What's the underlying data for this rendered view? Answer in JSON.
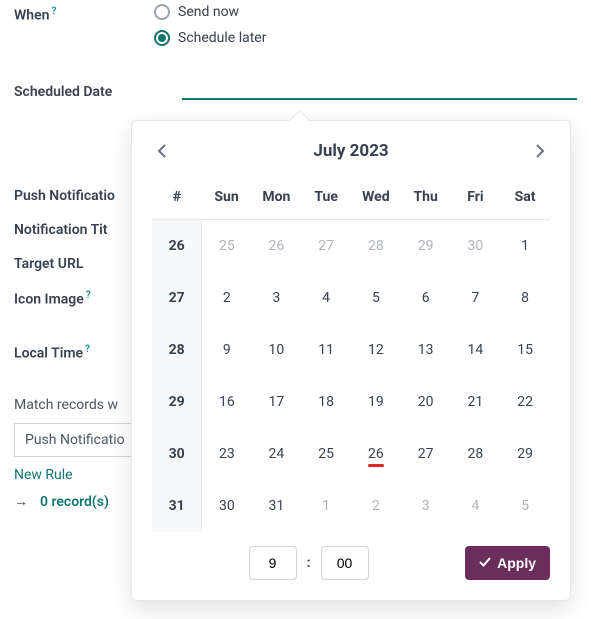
{
  "form": {
    "when_label": "When",
    "send_now_label": "Send now",
    "schedule_later_label": "Schedule later",
    "scheduled_date_label": "Scheduled Date",
    "scheduled_date_value": "",
    "push_section_label": "Push Notificatio",
    "notification_title_label": "Notification Tit",
    "target_url_label": "Target URL",
    "icon_image_label": "Icon Image",
    "local_time_label": "Local Time",
    "match_label": "Match records w",
    "rule_field": "Push Notificatio",
    "new_rule_label": "New Rule",
    "records_label": "0 record(s)"
  },
  "calendar": {
    "title": "July 2023",
    "headers": [
      "#",
      "Sun",
      "Mon",
      "Tue",
      "Wed",
      "Thu",
      "Fri",
      "Sat"
    ],
    "weeks": [
      {
        "wk": "26",
        "days": [
          {
            "n": "25",
            "muted": true
          },
          {
            "n": "26",
            "muted": true
          },
          {
            "n": "27",
            "muted": true
          },
          {
            "n": "28",
            "muted": true
          },
          {
            "n": "29",
            "muted": true
          },
          {
            "n": "30",
            "muted": true
          },
          {
            "n": "1",
            "muted": false
          }
        ]
      },
      {
        "wk": "27",
        "days": [
          {
            "n": "2"
          },
          {
            "n": "3"
          },
          {
            "n": "4"
          },
          {
            "n": "5"
          },
          {
            "n": "6"
          },
          {
            "n": "7"
          },
          {
            "n": "8"
          }
        ]
      },
      {
        "wk": "28",
        "days": [
          {
            "n": "9"
          },
          {
            "n": "10"
          },
          {
            "n": "11"
          },
          {
            "n": "12"
          },
          {
            "n": "13"
          },
          {
            "n": "14"
          },
          {
            "n": "15"
          }
        ]
      },
      {
        "wk": "29",
        "days": [
          {
            "n": "16"
          },
          {
            "n": "17"
          },
          {
            "n": "18"
          },
          {
            "n": "19"
          },
          {
            "n": "20"
          },
          {
            "n": "21"
          },
          {
            "n": "22"
          }
        ]
      },
      {
        "wk": "30",
        "days": [
          {
            "n": "23"
          },
          {
            "n": "24"
          },
          {
            "n": "25"
          },
          {
            "n": "26",
            "today": true
          },
          {
            "n": "27"
          },
          {
            "n": "28"
          },
          {
            "n": "29"
          }
        ]
      },
      {
        "wk": "31",
        "days": [
          {
            "n": "30"
          },
          {
            "n": "31"
          },
          {
            "n": "1",
            "muted": true
          },
          {
            "n": "2",
            "muted": true
          },
          {
            "n": "3",
            "muted": true
          },
          {
            "n": "4",
            "muted": true
          },
          {
            "n": "5",
            "muted": true
          }
        ]
      }
    ],
    "time": {
      "hour": "9",
      "minute": "00",
      "sep": ":"
    },
    "apply_label": "Apply"
  }
}
